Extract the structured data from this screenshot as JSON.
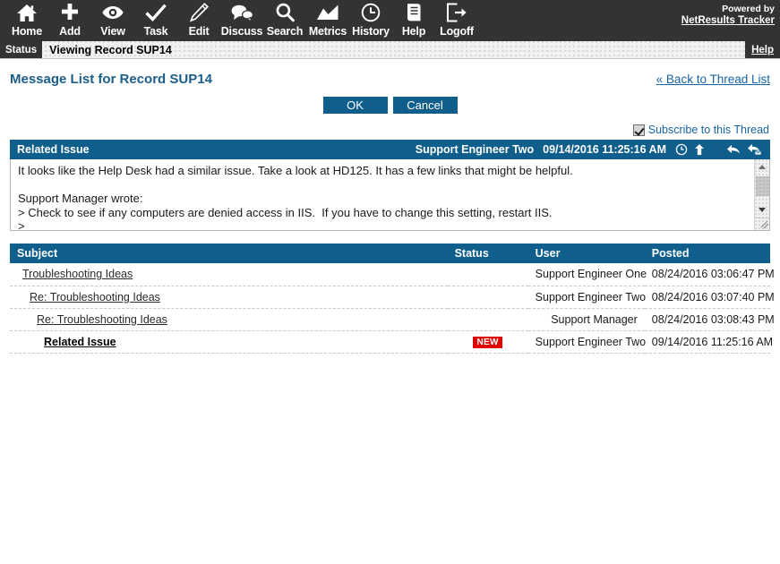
{
  "toolbar": {
    "items": [
      {
        "label": "Home",
        "icon": "home-icon"
      },
      {
        "label": "Add",
        "icon": "plus-icon"
      },
      {
        "label": "View",
        "icon": "eye-icon"
      },
      {
        "label": "Task",
        "icon": "check-icon"
      },
      {
        "label": "Edit",
        "icon": "pencil-icon"
      },
      {
        "label": "Discuss",
        "icon": "speech-bubbles-icon"
      },
      {
        "label": "Search",
        "icon": "magnifier-icon"
      },
      {
        "label": "Metrics",
        "icon": "chart-icon"
      },
      {
        "label": "History",
        "icon": "clock-icon"
      },
      {
        "label": "Help",
        "icon": "document-icon"
      },
      {
        "label": "Logoff",
        "icon": "exit-icon"
      }
    ],
    "powered_by": "Powered by",
    "brand": "NetResults Tracker"
  },
  "statusbar": {
    "label": "Status",
    "text": "Viewing Record SUP14",
    "help": "Help"
  },
  "page": {
    "title": "Message List for Record SUP14",
    "back_link": "« Back to Thread List",
    "ok_label": "OK",
    "cancel_label": "Cancel",
    "subscribe_label": "Subscribe to this Thread",
    "subscribe_checked": "true"
  },
  "message": {
    "subject": "Related Issue",
    "author": "Support Engineer Two",
    "date": "09/14/2016 11:25:16 AM",
    "body": "It looks like the Help Desk had a similar issue. Take a look at HD125. It has a few links that might be helpful.\n\nSupport Manager wrote:\n> Check to see if any computers are denied access in IIS.  If you have to change this setting, restart IIS.\n>"
  },
  "thread_table": {
    "columns": {
      "subject": "Subject",
      "status": "Status",
      "user": "User",
      "posted": "Posted"
    },
    "rows": [
      {
        "subject": "Troubleshooting Ideas",
        "indent": 0,
        "status": "",
        "user": "Support Engineer One",
        "posted": "08/24/2016 03:06:47 PM",
        "unread": "false"
      },
      {
        "subject": "Re: Troubleshooting Ideas",
        "indent": 1,
        "status": "",
        "user": "Support Engineer Two",
        "posted": "08/24/2016 03:07:40 PM",
        "unread": "false"
      },
      {
        "subject": "Re: Troubleshooting Ideas",
        "indent": 2,
        "status": "",
        "user": "Support Manager",
        "posted": "08/24/2016 03:08:43 PM",
        "unread": "false"
      },
      {
        "subject": "Related Issue",
        "indent": 3,
        "status": "NEW",
        "user": "Support Engineer Two",
        "posted": "09/14/2016 11:25:16 AM",
        "unread": "true"
      }
    ]
  },
  "colors": {
    "toolbar_bg": "#333333",
    "accent_blue": "#0f5e8c",
    "link_blue": "#1763a6",
    "title_blue": "#1b5e8c",
    "badge_red": "#e00000"
  }
}
